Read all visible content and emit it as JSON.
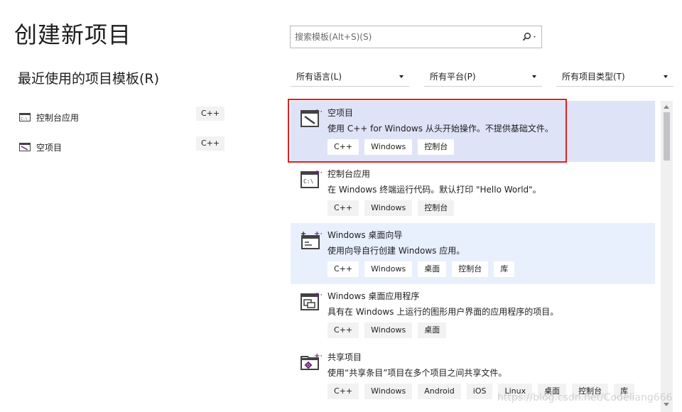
{
  "page_title": "创建新项目",
  "search": {
    "placeholder": "搜索模板(Alt+S)(S)",
    "icon": "search-icon"
  },
  "recent": {
    "title": "最近使用的项目模板(R)",
    "items": [
      {
        "label": "控制台应用",
        "tag": "C++",
        "icon": "console-app-icon"
      },
      {
        "label": "空项目",
        "tag": "C++",
        "icon": "empty-project-icon"
      }
    ]
  },
  "filters": {
    "language": "所有语言(L)",
    "platform": "所有平台(P)",
    "project_type": "所有项目类型(T)"
  },
  "templates": [
    {
      "name": "空项目",
      "description": "使用 C++ for Windows 从头开始操作。不提供基础文件。",
      "tags": [
        "C++",
        "Windows",
        "控制台"
      ],
      "icon": "empty-project-icon",
      "state": "selected"
    },
    {
      "name": "控制台应用",
      "description": "在 Windows 终端运行代码。默认打印 \"Hello World\"。",
      "tags": [
        "C++",
        "Windows",
        "控制台"
      ],
      "icon": "console-app-icon",
      "state": "normal"
    },
    {
      "name": "Windows 桌面向导",
      "description": "使用向导自行创建 Windows 应用。",
      "tags": [
        "C++",
        "Windows",
        "桌面",
        "控制台",
        "库"
      ],
      "icon": "desktop-wizard-icon",
      "state": "hover"
    },
    {
      "name": "Windows 桌面应用程序",
      "description": "具有在 Windows 上运行的图形用户界面的应用程序的项目。",
      "tags": [
        "C++",
        "Windows",
        "桌面"
      ],
      "icon": "desktop-app-icon",
      "state": "normal"
    },
    {
      "name": "共享项目",
      "description": "使用“共享条目”项目在多个项目之间共享文件。",
      "tags": [
        "C++",
        "Windows",
        "Android",
        "iOS",
        "Linux",
        "桌面",
        "控制台",
        "库"
      ],
      "icon": "shared-project-icon",
      "state": "normal"
    }
  ],
  "watermark": "https://blog.csdn.net/Codeliang666",
  "colors": {
    "selected_bg": "#dfe3f7",
    "hover_bg": "#e8effd",
    "highlight_border": "#e02020",
    "accent_purple": "#68217a"
  }
}
